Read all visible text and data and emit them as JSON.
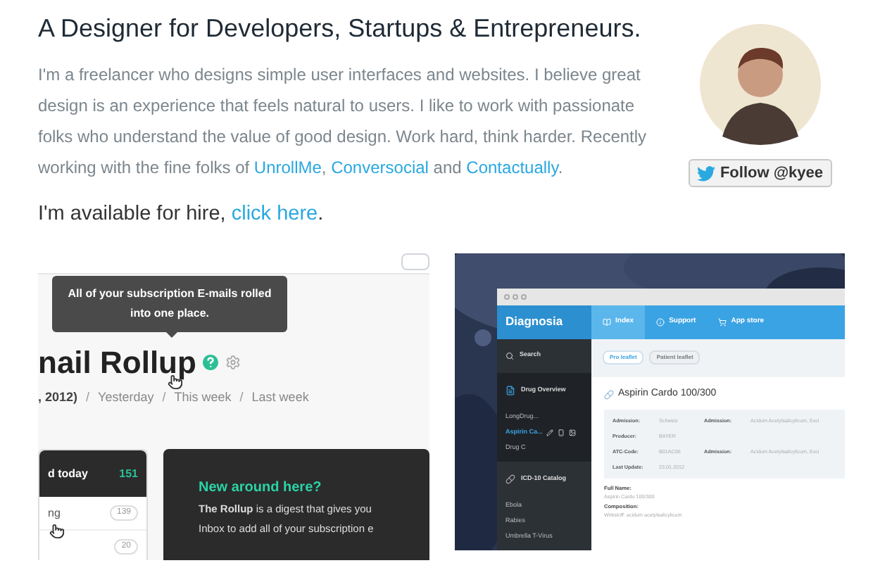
{
  "heading": "A Designer for Developers, Startups & Entrepreneurs.",
  "intro": [
    {
      "kind": "text",
      "text": "I'm a freelancer who designs simple user interfaces and websites. I believe great design is an experience that feels natural to users. I like to work with passionate folks who understand the value of good design. Work hard, think harder. Recently working with the fine folks of "
    },
    {
      "kind": "link",
      "text": "UnrollMe"
    },
    {
      "kind": "text",
      "text": ", "
    },
    {
      "kind": "link",
      "text": "Conversocial"
    },
    {
      "kind": "text",
      "text": " and "
    },
    {
      "kind": "link",
      "text": "Contactually"
    },
    {
      "kind": "text",
      "text": "."
    }
  ],
  "hire": [
    {
      "kind": "text",
      "text": "I'm available for hire, "
    },
    {
      "kind": "link",
      "text": "click here"
    },
    {
      "kind": "text",
      "text": "."
    }
  ],
  "follow_button": "Follow @kyee",
  "rollup": {
    "tooltip": "All of your subscription E-mails rolled into one place.",
    "title": "nail Rollup",
    "breadcrumbs": [
      {
        "kind": "current",
        "text": ", 2012)"
      },
      {
        "kind": "separator",
        "text": "/"
      },
      {
        "kind": "link",
        "text": "Yesterday"
      },
      {
        "kind": "separator",
        "text": "/"
      },
      {
        "kind": "link",
        "text": "This week"
      },
      {
        "kind": "separator",
        "text": "/"
      },
      {
        "kind": "link",
        "text": "Last week"
      }
    ],
    "list_header": {
      "label": "d today",
      "count": "151"
    },
    "list_rows": [
      {
        "label": "ng",
        "count": "139"
      },
      {
        "count": "20"
      }
    ],
    "promo": {
      "title": "New around here?",
      "lines": [
        "**The Rollup** is a digest that gives you",
        "Inbox to add all of your subscription e"
      ]
    }
  },
  "diagnosia": {
    "app_name": "Diagnosia",
    "tabs": [
      {
        "label": "Index",
        "selected": true
      },
      {
        "label": "Support",
        "selected": false
      },
      {
        "label": "App store",
        "selected": false
      }
    ],
    "search": "Search",
    "sections": [
      {
        "title": "Drug Overview",
        "items": [
          {
            "label": "LongDrug...",
            "selected": false
          },
          {
            "label": "Aspirin Ca...",
            "selected": true
          },
          {
            "label": "Drug C",
            "selected": false
          }
        ]
      },
      {
        "title": "ICD-10 Catalog",
        "items": [
          {
            "label": "Ebola",
            "selected": false
          },
          {
            "label": "Rabies",
            "selected": false
          },
          {
            "label": "Umbrella T-Virus",
            "selected": false
          }
        ]
      }
    ],
    "leaflet_tabs": [
      {
        "label": "Pro leaflet",
        "selected": true
      },
      {
        "label": "Patient leaflet",
        "selected": false
      }
    ],
    "drug_title": "Aspirin Cardo 100/300",
    "details": [
      [
        {
          "label": "Admission:",
          "value": "Schweiz"
        },
        {
          "label": "Admission:",
          "value": "Acidum Acetylsalicylicum, Exci"
        }
      ],
      [
        {
          "label": "Producer:",
          "value": "BAYER"
        }
      ],
      [
        {
          "label": "ATC-Code:",
          "value": "B01AC06"
        },
        {
          "label": "Admission:",
          "value": "Acidum Acetylsalicylicum, Exci"
        }
      ],
      [
        {
          "label": "Last Update:",
          "value": "23.01.2012"
        }
      ]
    ],
    "fields": [
      {
        "label": "Full Name:",
        "value": "Aspirin Cardo 100/300"
      },
      {
        "label": "Composition:",
        "value": "Wirkstoff: acidum acetylsalicylicum"
      }
    ]
  }
}
